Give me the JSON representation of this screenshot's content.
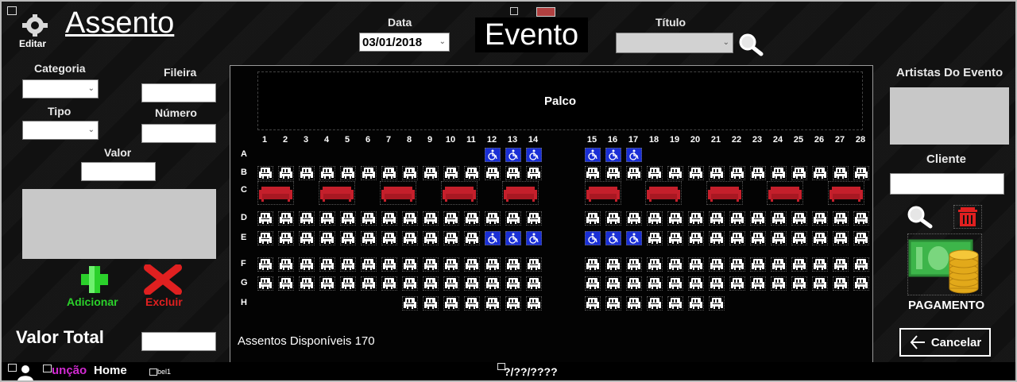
{
  "header": {
    "page_title": "Assento",
    "edit_label": "Editar",
    "date_label": "Data",
    "date_value": "03/01/2018",
    "event_title": "Evento",
    "titulo_label": "Título",
    "titulo_value": ""
  },
  "left_panel": {
    "categoria_label": "Categoria",
    "fileira_label": "Fileira",
    "tipo_label": "Tipo",
    "numero_label": "Número",
    "valor_label": "Valor",
    "add_label": "Adicionar",
    "delete_label": "Excluir",
    "valor_total_label": "Valor Total"
  },
  "hall": {
    "stage_label": "Palco",
    "available_text": "Assentos Disponíveis 170",
    "columns_left": [
      "1",
      "2",
      "3",
      "4",
      "5",
      "6",
      "7",
      "8",
      "9",
      "10",
      "11",
      "12",
      "13",
      "14"
    ],
    "columns_right": [
      "15",
      "16",
      "17",
      "18",
      "19",
      "20",
      "21",
      "22",
      "23",
      "24",
      "25",
      "26",
      "27",
      "28"
    ],
    "rows": [
      "A",
      "B",
      "C",
      "D",
      "E",
      "F",
      "G",
      "H"
    ]
  },
  "right_panel": {
    "artists_label": "Artistas Do Evento",
    "client_label": "Cliente",
    "payment_label": "PAGAMENTO",
    "cancel_label": "Cancelar"
  },
  "status_bar": {
    "funcao_text": "unção",
    "home_text": "Home",
    "label1_text": "bel1",
    "date_text": "?/??/????"
  },
  "colors": {
    "background": "#111111",
    "seat": "#ffffff",
    "wheelchair_seat": "#1a2fd6",
    "sofa": "#c41f2b",
    "add_green": "#2bd12b",
    "delete_red": "#e02020",
    "funcao_magenta": "#d22ad2"
  },
  "icons": [
    "gear-icon",
    "search-icon",
    "plus-icon",
    "x-icon",
    "trash-icon",
    "money-icon",
    "arrow-left-icon",
    "user-icon"
  ]
}
